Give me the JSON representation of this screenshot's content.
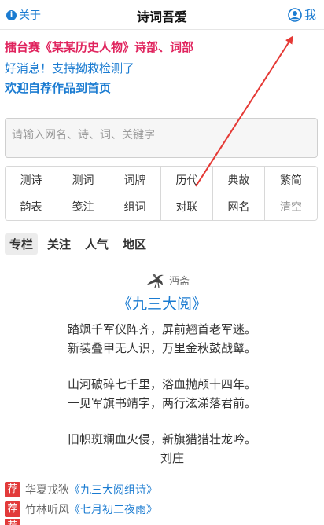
{
  "header": {
    "about_label": "关于",
    "title": "诗词吾爱",
    "me_label": "我"
  },
  "notices": [
    "擂台赛《某某历史人物》诗部、词部",
    "好消息！支持拗救检测了",
    "欢迎自荐作品到首页"
  ],
  "search": {
    "placeholder": "请输入网名、诗、词、关键字",
    "value": ""
  },
  "tools": [
    "测诗",
    "测词",
    "词牌",
    "历代",
    "典故",
    "繁简",
    "韵表",
    "笺注",
    "组词",
    "对联",
    "网名",
    "清空"
  ],
  "tabs": [
    "专栏",
    "关注",
    "人气",
    "地区"
  ],
  "active_tab": "专栏",
  "poem": {
    "author": "沔斋",
    "title": "《九三大阅》",
    "stanzas": [
      [
        "踏飒千军仪阵齐，屏前翘首老军迷。",
        "新装叠甲无人识，万里金秋鼓战鼙。"
      ],
      [
        "山河破碎七千里，浴血抛颅十四年。",
        "一见军旗书靖字，两行泫涕落君前。"
      ],
      [
        "旧帜斑斓血火侵，新旗猎猎壮龙吟。"
      ]
    ],
    "signature": "刘庄"
  },
  "recommendations": [
    {
      "badge": "荐",
      "author": "华夏戎狄",
      "title": "《九三大阅组诗》"
    },
    {
      "badge": "荐",
      "author": "竹林听风",
      "title": "《七月初二夜雨》"
    },
    {
      "badge": "荐",
      "author": "",
      "title": ""
    }
  ],
  "colors": {
    "accent": "#1a7bd1",
    "notice_red": "#e0245e",
    "badge_red": "#e23a3a",
    "annotation_arrow": "#e53935"
  },
  "icons": {
    "about": "info-circle-icon",
    "me": "user-circle-icon",
    "author_avatar": "bird-avatar-icon",
    "rec_badge": "recommend-badge-icon"
  }
}
